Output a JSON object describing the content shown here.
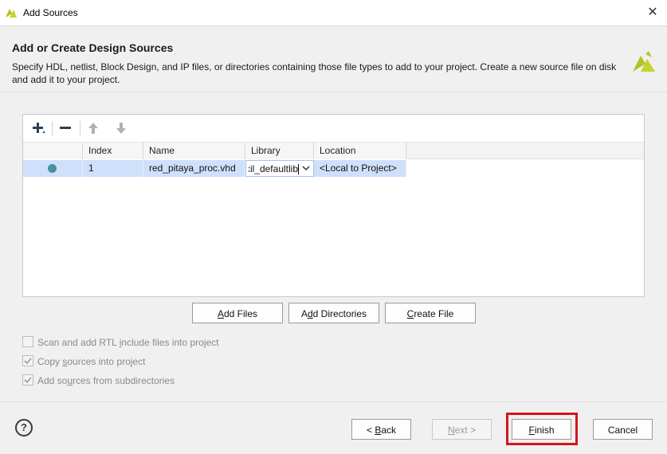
{
  "window": {
    "title": "Add Sources",
    "close_glyph": "✕"
  },
  "header": {
    "title": "Add or Create Design Sources",
    "description": "Specify HDL, netlist, Block Design, and IP files, or directories containing those file types to add to your project. Create a new source file on disk and add it to your project."
  },
  "toolbar": {
    "icons": [
      "plus-icon",
      "minus-icon",
      "arrow-up-icon",
      "arrow-down-icon"
    ]
  },
  "table": {
    "columns": [
      "Index",
      "Name",
      "Library",
      "Location"
    ],
    "rows": [
      {
        "index": "1",
        "name": "red_pitaya_proc.vhd",
        "library": "xil_defaultlib",
        "location": "<Local to Project>"
      }
    ]
  },
  "buttons": {
    "add_files_pre": "",
    "add_files_ul": "A",
    "add_files_post": "dd Files",
    "add_dirs_pre": "A",
    "add_dirs_ul": "d",
    "add_dirs_post": "d Directories",
    "create_file_pre": "",
    "create_file_ul": "C",
    "create_file_post": "reate File"
  },
  "options": [
    {
      "pre": "Scan and add RTL ",
      "ul": "i",
      "post": "nclude files into project",
      "checked": false
    },
    {
      "pre": "Copy ",
      "ul": "s",
      "post": "ources into project",
      "checked": true
    },
    {
      "pre": "Add so",
      "ul": "u",
      "post": "rces from subdirectories",
      "checked": true
    }
  ],
  "footer": {
    "help": "?",
    "back_pre": "< ",
    "back_ul": "B",
    "back_post": "ack",
    "next_pre": "",
    "next_ul": "N",
    "next_post": "ext >",
    "finish_pre": "",
    "finish_ul": "F",
    "finish_post": "inish",
    "cancel": "Cancel"
  },
  "colors": {
    "highlight": "#d4141b",
    "selected_row": "#cfe0fb",
    "status_dot": "#4a8fa3",
    "logo": "#c8d22c"
  }
}
